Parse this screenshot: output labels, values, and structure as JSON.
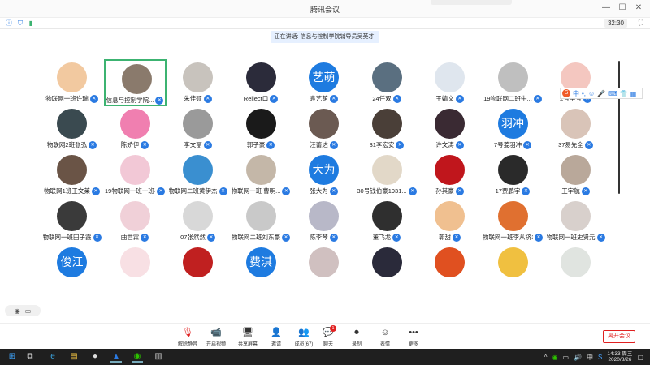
{
  "window": {
    "title": "腾讯会议",
    "timer": "32:30",
    "speaking_banner": "正在讲话: 信息与控制学院辅导员吴英才;"
  },
  "colors": {
    "accent": "#2a7ae2",
    "active_border": "#3cb371",
    "leave": "#e02020",
    "taskbar": "#1f1f1f"
  },
  "participants": [
    {
      "name": "物联网一班许瑞",
      "avatar": "photo",
      "color": "#f2c9a0"
    },
    {
      "name": "信息与控制学院...",
      "avatar": "photo",
      "color": "#8a7a6c",
      "active": true
    },
    {
      "name": "朱佳硕",
      "avatar": "photo",
      "color": "#c8c3bd"
    },
    {
      "name": "Reliect口",
      "avatar": "photo",
      "color": "#2b2b3a"
    },
    {
      "name": "袁艺萌",
      "avatar": "text",
      "avatar_text": "艺萌",
      "color": "#1e7be0"
    },
    {
      "name": "24任双",
      "avatar": "photo",
      "color": "#5a6f80"
    },
    {
      "name": "王婧文",
      "avatar": "photo",
      "color": "#dfe6ee"
    },
    {
      "name": "19物联网二班牛...",
      "avatar": "photo",
      "color": "#bfbfbf"
    },
    {
      "name": "2号李号",
      "avatar": "photo",
      "color": "#f4c7c0"
    },
    {
      "name": "物联网2班张弘",
      "avatar": "photo",
      "color": "#3a4a50"
    },
    {
      "name": "陈娇伊",
      "avatar": "photo",
      "color": "#f07fb0"
    },
    {
      "name": "李文丽",
      "avatar": "photo",
      "color": "#9a9a9a"
    },
    {
      "name": "郭子豪",
      "avatar": "photo",
      "color": "#1a1a1a"
    },
    {
      "name": "汪蕾达",
      "avatar": "photo",
      "color": "#6b5a52"
    },
    {
      "name": "31李宏安",
      "avatar": "photo",
      "color": "#4a3f38"
    },
    {
      "name": "许文涛",
      "avatar": "photo",
      "color": "#3a2a33"
    },
    {
      "name": "7号姜羽冲",
      "avatar": "text",
      "avatar_text": "羽冲",
      "color": "#1e7be0"
    },
    {
      "name": "37易先全",
      "avatar": "photo",
      "color": "#d9c4b8"
    },
    {
      "name": "物联网1班王文莱",
      "avatar": "photo",
      "color": "#6a5446"
    },
    {
      "name": "19物联网一班一班马...",
      "avatar": "photo",
      "color": "#f2c8d6"
    },
    {
      "name": "物联网二班黄伊杰",
      "avatar": "photo",
      "color": "#3a8fd0"
    },
    {
      "name": "物联网一班 曹明...",
      "avatar": "photo",
      "color": "#c4b7a8"
    },
    {
      "name": "张大为",
      "avatar": "text",
      "avatar_text": "大为",
      "color": "#1e7be0"
    },
    {
      "name": "30号钱伯豪1931...",
      "avatar": "photo",
      "color": "#e2d8c8"
    },
    {
      "name": "孙其豪",
      "avatar": "photo",
      "color": "#c0161c"
    },
    {
      "name": "17贾鹏宇",
      "avatar": "photo",
      "color": "#2a2a2a"
    },
    {
      "name": "王宇航",
      "avatar": "photo",
      "color": "#b9a89a"
    },
    {
      "name": "物联网一班田子霞",
      "avatar": "photo",
      "color": "#3a3a3a"
    },
    {
      "name": "曲世霖",
      "avatar": "photo",
      "color": "#f0d0d8"
    },
    {
      "name": "07张然然",
      "avatar": "photo",
      "color": "#d8d8d8"
    },
    {
      "name": "物联网二班刘东豪",
      "avatar": "photo",
      "color": "#c9c9c9"
    },
    {
      "name": "陈李琴",
      "avatar": "photo",
      "color": "#b8b8c8"
    },
    {
      "name": "董飞龙",
      "avatar": "photo",
      "color": "#2f2f2f"
    },
    {
      "name": "郭甜",
      "avatar": "photo",
      "color": "#f0c090"
    },
    {
      "name": "物联网一班李从挤19...",
      "avatar": "photo",
      "color": "#e07030"
    },
    {
      "name": "物联网一班史贤元",
      "avatar": "photo",
      "color": "#d8d0cc"
    },
    {
      "name": "",
      "avatar": "text",
      "avatar_text": "俊江",
      "color": "#1e7be0"
    },
    {
      "name": "",
      "avatar": "photo",
      "color": "#f8e0e4"
    },
    {
      "name": "",
      "avatar": "photo",
      "color": "#c02020"
    },
    {
      "name": "",
      "avatar": "text",
      "avatar_text": "费淇",
      "color": "#1e7be0"
    },
    {
      "name": "",
      "avatar": "photo",
      "color": "#d0c0c0"
    },
    {
      "name": "",
      "avatar": "photo",
      "color": "#2a2a3a"
    },
    {
      "name": "",
      "avatar": "photo",
      "color": "#e05020"
    },
    {
      "name": "",
      "avatar": "photo",
      "color": "#f0c040"
    },
    {
      "name": "",
      "avatar": "photo",
      "color": "#e0e4e0"
    }
  ],
  "toolbar": {
    "buttons": [
      {
        "label": "解除静音",
        "icon": "mic-muted-icon",
        "glyph": "🎙"
      },
      {
        "label": "开启视频",
        "icon": "video-off-icon",
        "glyph": "📹"
      },
      {
        "label": "共享屏幕",
        "icon": "share-screen-icon",
        "glyph": "🖥"
      },
      {
        "label": "邀请",
        "icon": "invite-icon",
        "glyph": "👤"
      },
      {
        "label": "成员(67)",
        "icon": "members-icon",
        "glyph": "👥"
      },
      {
        "label": "聊天",
        "icon": "chat-icon",
        "glyph": "💬",
        "badge": "1"
      },
      {
        "label": "录制",
        "icon": "record-icon",
        "glyph": "⏺"
      },
      {
        "label": "表情",
        "icon": "emoji-icon",
        "glyph": "☺"
      },
      {
        "label": "更多",
        "icon": "more-icon",
        "glyph": "•••"
      }
    ],
    "leave_label": "离开会议"
  },
  "ime": {
    "mode": "中"
  },
  "taskbar": {
    "ime": "中",
    "time": "14:33 周三",
    "date": "2020/8/26"
  }
}
